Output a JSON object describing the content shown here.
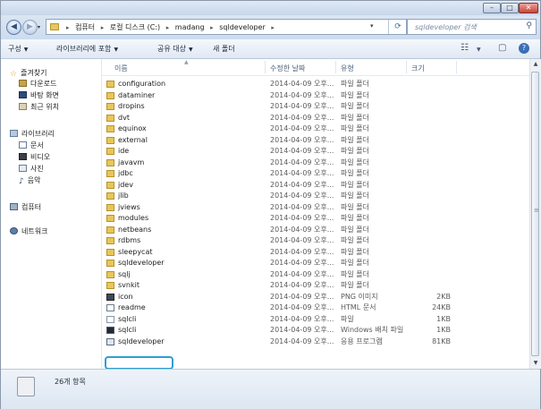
{
  "window": {
    "caption_buttons": {
      "minimize": "–",
      "maximize": "□",
      "close": "✕"
    }
  },
  "nav_buttons": {
    "back": "◀",
    "forward": "▶",
    "history": "▾"
  },
  "address": {
    "breadcrumbs": [
      "컴퓨터",
      "로컬 디스크 (C:)",
      "madang",
      "sqldeveloper"
    ],
    "dropdown": "▾",
    "refresh": "⟳"
  },
  "search": {
    "placeholder": "sqldeveloper 검색",
    "icon": "search-icon"
  },
  "toolbar": {
    "organize": "구성",
    "include_library": "라이브러리에 포함",
    "share_with": "공유 대상",
    "new_folder": "새 폴더",
    "view_icon": "☷",
    "preview_icon": "▢",
    "help_icon": "?"
  },
  "sidebar": {
    "favorites": {
      "label": "즐겨찾기",
      "icon": "star-icon"
    },
    "favorites_items": [
      {
        "label": "다운로드",
        "icon": "download-folder-icon"
      },
      {
        "label": "바탕 화면",
        "icon": "desktop-icon"
      },
      {
        "label": "최근 위치",
        "icon": "recent-places-icon"
      }
    ],
    "libraries": {
      "label": "라이브러리",
      "icon": "library-icon"
    },
    "libraries_items": [
      {
        "label": "문서",
        "icon": "documents-icon"
      },
      {
        "label": "비디오",
        "icon": "video-icon"
      },
      {
        "label": "사진",
        "icon": "pictures-icon"
      },
      {
        "label": "음악",
        "icon": "music-icon"
      }
    ],
    "computer": {
      "label": "컴퓨터",
      "icon": "computer-icon"
    },
    "network": {
      "label": "네트워크",
      "icon": "network-icon"
    }
  },
  "columns": {
    "name": "이름",
    "date": "수정한 날짜",
    "type": "유형",
    "size": "크기"
  },
  "files": [
    {
      "name": "configuration",
      "date": "2014-04-09 오후...",
      "type": "파일 폴더",
      "size": "",
      "icon": "folder"
    },
    {
      "name": "dataminer",
      "date": "2014-04-09 오후...",
      "type": "파일 폴더",
      "size": "",
      "icon": "folder"
    },
    {
      "name": "dropins",
      "date": "2014-04-09 오후...",
      "type": "파일 폴더",
      "size": "",
      "icon": "folder"
    },
    {
      "name": "dvt",
      "date": "2014-04-09 오후...",
      "type": "파일 폴더",
      "size": "",
      "icon": "folder"
    },
    {
      "name": "equinox",
      "date": "2014-04-09 오후...",
      "type": "파일 폴더",
      "size": "",
      "icon": "folder"
    },
    {
      "name": "external",
      "date": "2014-04-09 오후...",
      "type": "파일 폴더",
      "size": "",
      "icon": "folder"
    },
    {
      "name": "ide",
      "date": "2014-04-09 오후...",
      "type": "파일 폴더",
      "size": "",
      "icon": "folder"
    },
    {
      "name": "javavm",
      "date": "2014-04-09 오후...",
      "type": "파일 폴더",
      "size": "",
      "icon": "folder"
    },
    {
      "name": "jdbc",
      "date": "2014-04-09 오후...",
      "type": "파일 폴더",
      "size": "",
      "icon": "folder"
    },
    {
      "name": "jdev",
      "date": "2014-04-09 오후...",
      "type": "파일 폴더",
      "size": "",
      "icon": "folder"
    },
    {
      "name": "jlib",
      "date": "2014-04-09 오후...",
      "type": "파일 폴더",
      "size": "",
      "icon": "folder"
    },
    {
      "name": "jviews",
      "date": "2014-04-09 오후...",
      "type": "파일 폴더",
      "size": "",
      "icon": "folder"
    },
    {
      "name": "modules",
      "date": "2014-04-09 오후...",
      "type": "파일 폴더",
      "size": "",
      "icon": "folder"
    },
    {
      "name": "netbeans",
      "date": "2014-04-09 오후...",
      "type": "파일 폴더",
      "size": "",
      "icon": "folder"
    },
    {
      "name": "rdbms",
      "date": "2014-04-09 오후...",
      "type": "파일 폴더",
      "size": "",
      "icon": "folder"
    },
    {
      "name": "sleepycat",
      "date": "2014-04-09 오후...",
      "type": "파일 폴더",
      "size": "",
      "icon": "folder"
    },
    {
      "name": "sqldeveloper",
      "date": "2014-04-09 오후...",
      "type": "파일 폴더",
      "size": "",
      "icon": "folder"
    },
    {
      "name": "sqlj",
      "date": "2014-04-09 오후...",
      "type": "파일 폴더",
      "size": "",
      "icon": "folder"
    },
    {
      "name": "svnkit",
      "date": "2014-04-09 오후...",
      "type": "파일 폴더",
      "size": "",
      "icon": "folder"
    },
    {
      "name": "icon",
      "date": "2014-04-09 오후...",
      "type": "PNG 이미지",
      "size": "2KB",
      "icon": "png"
    },
    {
      "name": "readme",
      "date": "2014-04-09 오후...",
      "type": "HTML 문서",
      "size": "24KB",
      "icon": "html"
    },
    {
      "name": "sqlcli",
      "date": "2014-04-09 오후...",
      "type": "파일",
      "size": "1KB",
      "icon": "blank"
    },
    {
      "name": "sqlcli",
      "date": "2014-04-09 오후...",
      "type": "Windows 배치 파일",
      "size": "1KB",
      "icon": "cmd"
    },
    {
      "name": "sqldeveloper",
      "date": "2014-04-09 오후...",
      "type": "응용 프로그램",
      "size": "81KB",
      "icon": "exe"
    }
  ],
  "scrollbar": {
    "up": "▲",
    "down": "▼",
    "grip": "≡"
  },
  "status": {
    "item_count": "26개 항목"
  }
}
